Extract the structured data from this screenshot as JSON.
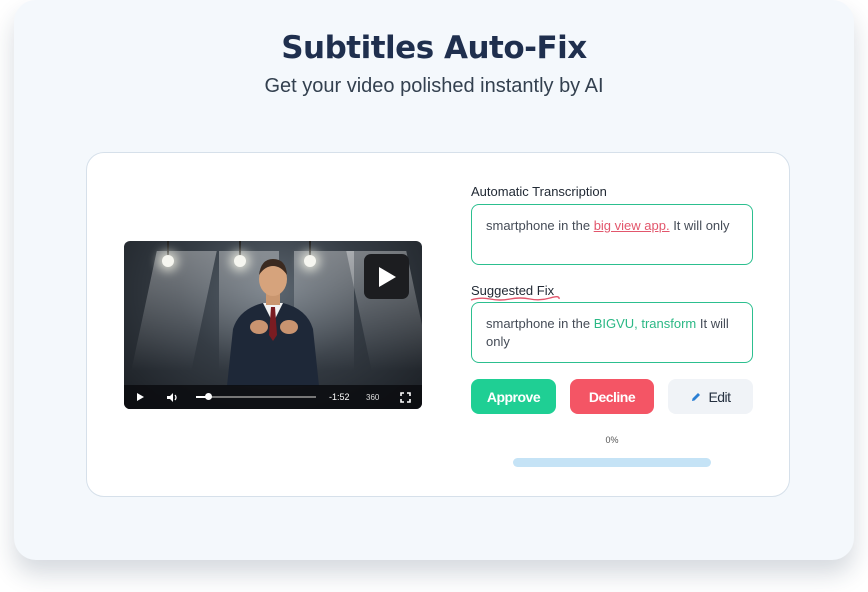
{
  "header": {
    "title": "Subtitles Auto-Fix",
    "subtitle": "Get your video polished instantly by AI"
  },
  "video": {
    "time_remaining": "-1:52",
    "quality_label": "360",
    "progress_fraction": 0.1,
    "icons": [
      "play-icon",
      "volume-icon",
      "fullscreen-icon",
      "play-overlay-icon"
    ]
  },
  "transcription": {
    "label": "Automatic Transcription",
    "text_before": "smartphone in the ",
    "text_error": "big view app.",
    "text_after": " It will only"
  },
  "suggestion": {
    "label": "Suggested Fix",
    "text_before": "smartphone in the ",
    "text_fix": "BIGVU, transform",
    "text_after": " It will only"
  },
  "actions": {
    "approve_label": "Approve",
    "decline_label": "Decline",
    "edit_label": "Edit"
  },
  "progress": {
    "label": "0%",
    "value": 0
  },
  "colors": {
    "accent_green": "#1fcf94",
    "decline_red": "#f45565",
    "title_navy": "#1f2f4e",
    "error_red": "#e2566c"
  }
}
